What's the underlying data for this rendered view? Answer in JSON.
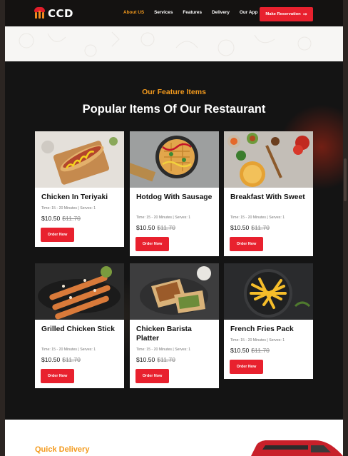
{
  "nav": {
    "logo_text": "CCD",
    "links": [
      "About US",
      "Services",
      "Features",
      "Delivery",
      "Our App"
    ],
    "active_link": "About US",
    "cta": "Make Reservation",
    "cta_icon": "arrow-right-icon"
  },
  "features": {
    "kicker": "Our Feature Items",
    "title": "Popular Items Of Our Restaurant",
    "items": [
      {
        "name": "Chicken In Teriyaki",
        "meta": "Time: 15 - 20 Minutes | Serves: 1",
        "price": "$10.50",
        "old_price": "$11.70",
        "button": "Order Now",
        "photo": "hotdog-on-board"
      },
      {
        "name": "Hotdog With Sausage",
        "meta": "Time: 15 - 20 Minutes | Serves: 1",
        "price": "$10.50",
        "old_price": "$11.70",
        "button": "Order Now",
        "photo": "waffle-pan"
      },
      {
        "name": "Breakfast With Sweet",
        "meta": "Time: 15 - 20 Minutes | Serves: 1",
        "price": "$10.50",
        "old_price": "$11.70",
        "button": "Order Now",
        "photo": "sauce-bowls"
      },
      {
        "name": "Grilled Chicken Stick",
        "meta": "Time: 15 - 20 Minutes | Serves: 1",
        "price": "$10.50",
        "old_price": "$11.70",
        "button": "Order Now",
        "photo": "skewers"
      },
      {
        "name": "Chicken Barista Platter",
        "meta": "Time: 15 - 20 Minutes | Serves: 1",
        "price": "$10.50",
        "old_price": "$11.70",
        "button": "Order Now",
        "photo": "wrap"
      },
      {
        "name": "French Fries Pack",
        "meta": "Time: 15 - 20 Minutes | Serves: 1",
        "price": "$10.50",
        "old_price": "$11.70",
        "button": "Order Now",
        "photo": "fries"
      }
    ]
  },
  "delivery": {
    "label": "Quick Delivery"
  },
  "colors": {
    "accent": "#f39a1d",
    "brand_red": "#e8212e",
    "dark": "#141414"
  }
}
